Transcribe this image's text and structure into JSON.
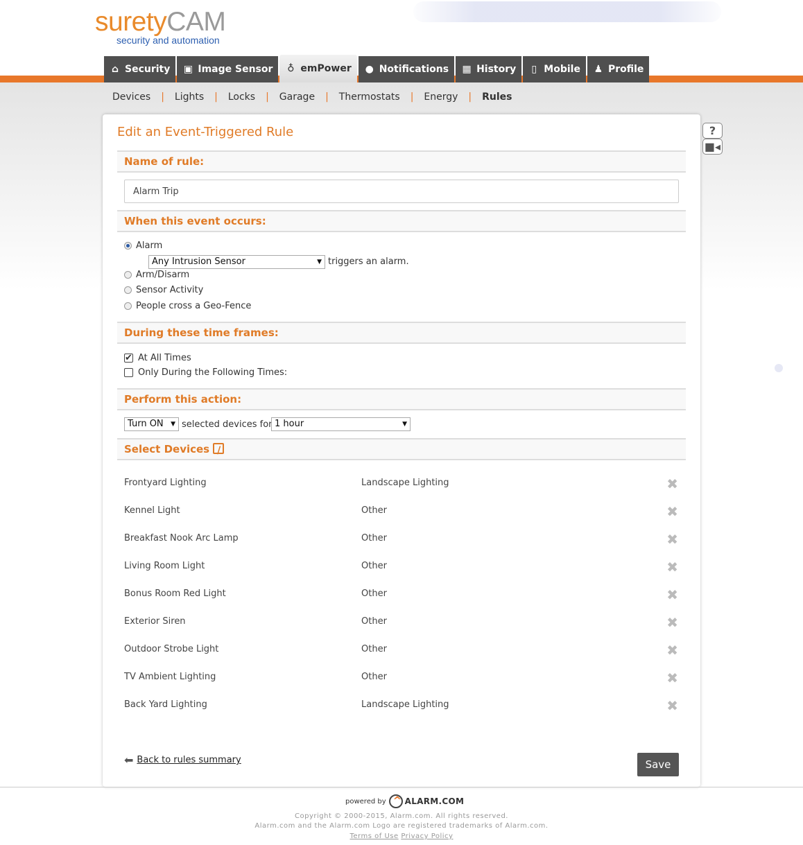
{
  "logo": {
    "part1": "surety",
    "part2": "CAM",
    "tagline": "security and automation"
  },
  "tabs": [
    {
      "label": "Security",
      "icon": "home-icon"
    },
    {
      "label": "Image Sensor",
      "icon": "camera-icon"
    },
    {
      "label": "emPower",
      "icon": "lightbulb-icon"
    },
    {
      "label": "Notifications",
      "icon": "chat-icon"
    },
    {
      "label": "History",
      "icon": "calendar-icon"
    },
    {
      "label": "Mobile",
      "icon": "phone-icon"
    },
    {
      "label": "Profile",
      "icon": "user-icon"
    }
  ],
  "subnav": [
    "Devices",
    "Lights",
    "Locks",
    "Garage",
    "Thermostats",
    "Energy",
    "Rules"
  ],
  "page": {
    "title": "Edit an Event-Triggered Rule",
    "name_label": "Name of rule:",
    "name_value": "Alarm Trip",
    "event_label": "When this event occurs:",
    "events": [
      "Alarm",
      "Arm/Disarm",
      "Sensor Activity",
      "People cross a Geo-Fence"
    ],
    "alarm_sensor": "Any Intrusion Sensor",
    "alarm_suffix": "triggers an alarm.",
    "time_label": "During these time frames:",
    "time_all": "At All Times",
    "time_following": "Only During the Following Times:",
    "action_label": "Perform this action:",
    "action_select": "Turn ON",
    "action_middle": "selected devices for",
    "duration_select": "1 hour",
    "devices_label": "Select Devices",
    "devices": [
      {
        "name": "Frontyard Lighting",
        "type": "Landscape Lighting"
      },
      {
        "name": "Kennel Light",
        "type": "Other"
      },
      {
        "name": "Breakfast Nook Arc Lamp",
        "type": "Other"
      },
      {
        "name": "Living Room Light",
        "type": "Other"
      },
      {
        "name": "Bonus Room Red Light",
        "type": "Other"
      },
      {
        "name": "Exterior Siren",
        "type": "Other"
      },
      {
        "name": "Outdoor Strobe Light",
        "type": "Other"
      },
      {
        "name": "TV Ambient Lighting",
        "type": "Other"
      },
      {
        "name": "Back Yard Lighting",
        "type": "Landscape Lighting"
      }
    ],
    "back_link": "Back to rules summary",
    "save_label": "Save",
    "help_label": "?"
  },
  "footer": {
    "powered_by": "powered by",
    "brand": "ALARM.COM",
    "copyright": "Copyright © 2000-2015, Alarm.com. All rights reserved.",
    "trademark": "Alarm.com and the Alarm.com Logo are registered trademarks of Alarm.com.",
    "terms": "Terms of Use",
    "privacy": "Privacy Policy"
  },
  "colors": {
    "accent": "#e8772a",
    "tab_bg": "#4f4f4f",
    "heading": "#e07b27"
  }
}
